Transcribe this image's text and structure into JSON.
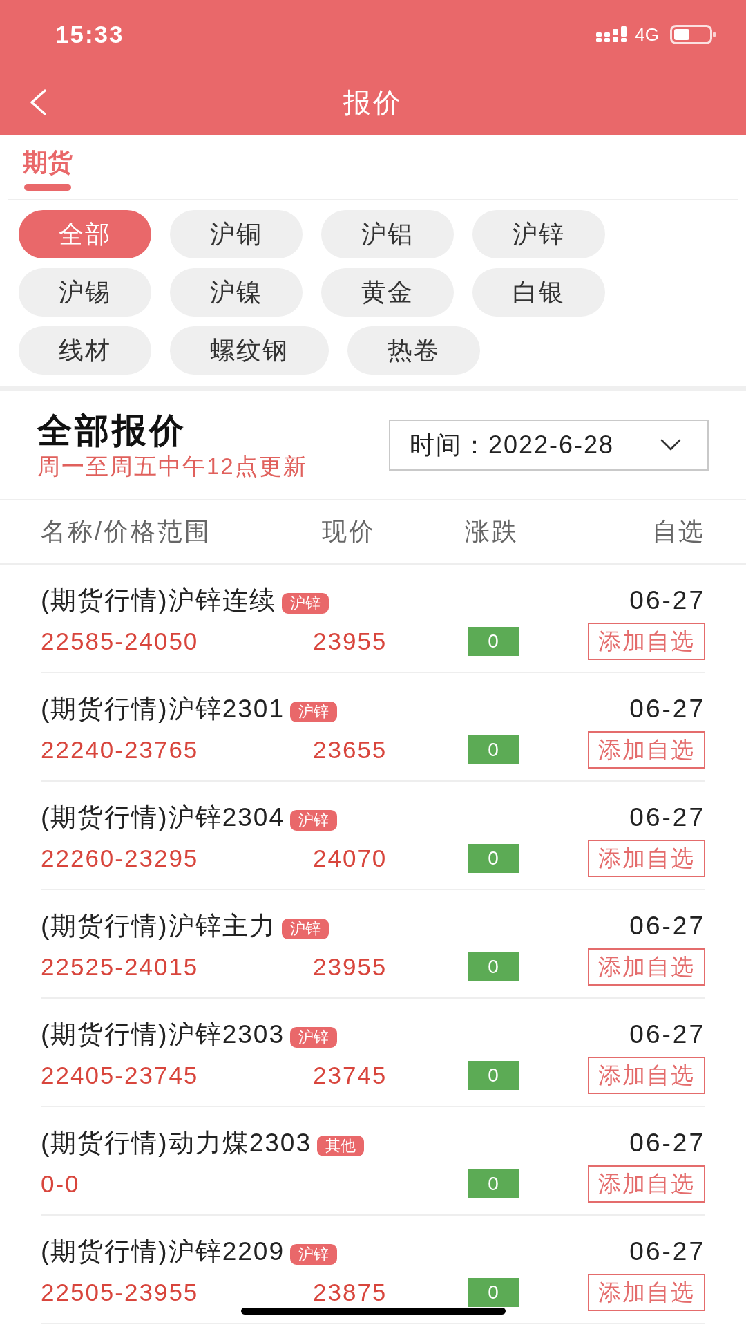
{
  "status_bar": {
    "time": "15:33",
    "network": "4G"
  },
  "nav_bar": {
    "title": "报价"
  },
  "tabs": [
    {
      "label": "期货",
      "selected": true
    }
  ],
  "filter_chips": [
    {
      "label": "全部",
      "selected": true
    },
    {
      "label": "沪铜",
      "selected": false
    },
    {
      "label": "沪铝",
      "selected": false
    },
    {
      "label": "沪锌",
      "selected": false
    },
    {
      "label": "沪锡",
      "selected": false
    },
    {
      "label": "沪镍",
      "selected": false
    },
    {
      "label": "黄金",
      "selected": false
    },
    {
      "label": "白银",
      "selected": false
    },
    {
      "label": "线材",
      "selected": false
    },
    {
      "label": "螺纹钢",
      "selected": false
    },
    {
      "label": "热卷",
      "selected": false
    }
  ],
  "section": {
    "title": "全部报价",
    "subtitle": "周一至周五中午12点更新",
    "date_picker": {
      "label": "时间：",
      "value": "2022-6-28"
    }
  },
  "table": {
    "columns": [
      "名称/价格范围",
      "现价",
      "涨跌",
      "自选"
    ],
    "rows": [
      {
        "name": "(期货行情)沪锌连续",
        "tag": "沪锌",
        "range": "22585-24050",
        "price": "23955",
        "change": "0",
        "date": "06-27",
        "action": "添加自选"
      },
      {
        "name": "(期货行情)沪锌2301",
        "tag": "沪锌",
        "range": "22240-23765",
        "price": "23655",
        "change": "0",
        "date": "06-27",
        "action": "添加自选"
      },
      {
        "name": "(期货行情)沪锌2304",
        "tag": "沪锌",
        "range": "22260-23295",
        "price": "24070",
        "change": "0",
        "date": "06-27",
        "action": "添加自选"
      },
      {
        "name": "(期货行情)沪锌主力",
        "tag": "沪锌",
        "range": "22525-24015",
        "price": "23955",
        "change": "0",
        "date": "06-27",
        "action": "添加自选"
      },
      {
        "name": "(期货行情)沪锌2303",
        "tag": "沪锌",
        "range": "22405-23745",
        "price": "23745",
        "change": "0",
        "date": "06-27",
        "action": "添加自选"
      },
      {
        "name": "(期货行情)动力煤2303",
        "tag": "其他",
        "range": "0-0",
        "change": "0",
        "date": "06-27",
        "action": "添加自选"
      },
      {
        "name": "(期货行情)沪锌2209",
        "tag": "沪锌",
        "range": "22505-23955",
        "price": "23875",
        "change": "0",
        "date": "06-27",
        "action": "添加自选"
      }
    ]
  }
}
